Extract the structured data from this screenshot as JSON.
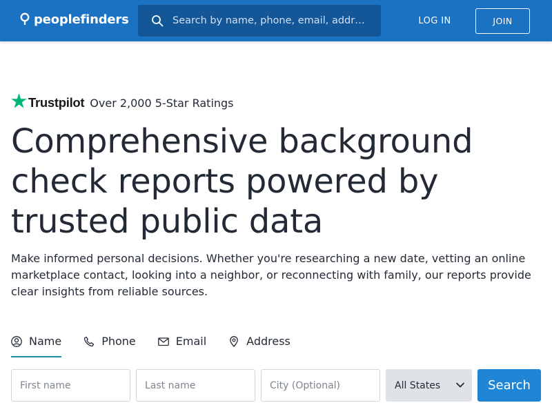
{
  "header": {
    "logo_text": "peoplefinders",
    "search_placeholder": "Search by name, phone, email, addr…",
    "login_label": "LOG IN",
    "join_label": "JOIN"
  },
  "trustpilot": {
    "brand": "Trustpilot",
    "rating_text": "Over 2,000 5-Star Ratings"
  },
  "hero": {
    "title": "Comprehensive background check reports powered by trusted public data",
    "subtitle": "Make informed personal decisions. Whether you're researching a new date, vetting an online marketplace contact, looking into a neighbor, or reconnecting with family, our reports provide clear insights from reliable sources."
  },
  "tabs": [
    {
      "label": "Name",
      "icon": "person-icon",
      "active": true
    },
    {
      "label": "Phone",
      "icon": "phone-icon",
      "active": false
    },
    {
      "label": "Email",
      "icon": "envelope-icon",
      "active": false
    },
    {
      "label": "Address",
      "icon": "map-pin-icon",
      "active": false
    }
  ],
  "form": {
    "first_name_placeholder": "First name",
    "last_name_placeholder": "Last name",
    "city_placeholder": "City (Optional)",
    "state_selected": "All States",
    "search_label": "Search"
  },
  "colors": {
    "header_bg": "#1b72c2",
    "search_bg": "#135799",
    "accent_button": "#1f85d4",
    "tab_underline": "#1b8fa8",
    "trustpilot_green": "#00b67a"
  }
}
